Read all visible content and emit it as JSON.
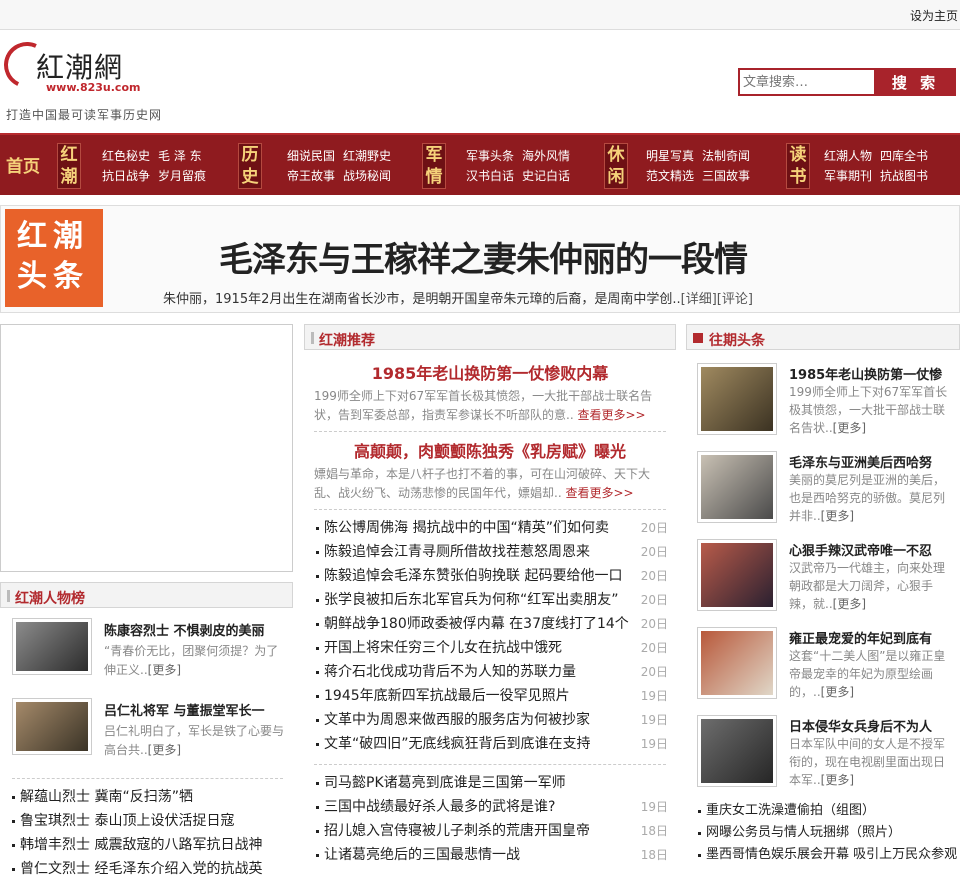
{
  "topbar": {
    "set_home": "设为主页"
  },
  "logo": {
    "name": "紅潮網",
    "url": "www.823u.com",
    "slogan": "打造中国最可读军事历史网"
  },
  "search": {
    "placeholder": "文章搜索…",
    "button": "搜 索"
  },
  "nav": {
    "home": "首页",
    "groups": [
      {
        "cat": "红潮",
        "links": [
          "红色秘史",
          "毛 泽 东",
          "抗日战争",
          "岁月留痕"
        ]
      },
      {
        "cat": "历史",
        "links": [
          "细说民国",
          "红潮野史",
          "帝王故事",
          "战场秘闻"
        ]
      },
      {
        "cat": "军情",
        "links": [
          "军事头条",
          "海外风情",
          "汉书白话",
          "史记白话"
        ]
      },
      {
        "cat": "休闲",
        "links": [
          "明星写真",
          "法制奇闻",
          "范文精选",
          "三国故事"
        ]
      },
      {
        "cat": "读书",
        "links": [
          "红潮人物",
          "四库全书",
          "军事期刊",
          "抗战图书"
        ]
      }
    ]
  },
  "headline": {
    "badge": "红潮头条",
    "title": "毛泽东与王稼祥之妻朱仲丽的一段情",
    "summary": "朱仲丽，1915年2月出生在湖南省长沙市，是明朝开国皇帝朱元璋的后裔，是周南中学创..",
    "detail": "[详细]",
    "comment": "[评论]"
  },
  "people": {
    "title": "红潮人物榜",
    "featured": [
      {
        "title": "陈康容烈士  不惧剥皮的美丽",
        "desc": "“青春价无比，团聚何须提？为了伸正义..",
        "more": "[更多]"
      },
      {
        "title": "吕仁礼将军  与董振堂军长一",
        "desc": "吕仁礼明白了，军长是铁了心要与高台共..",
        "more": "[更多]"
      }
    ],
    "list": [
      "解蕴山烈士  冀南“反扫荡”牺",
      "鲁宝琪烈士  泰山顶上设伏活捉日寇",
      "韩增丰烈士  威震敌寇的八路军抗日战神",
      "曾仁文烈士  经毛泽东介绍入党的抗战英"
    ]
  },
  "recommend": {
    "title": "红潮推荐",
    "items": [
      {
        "title": "1985年老山换防第一仗惨败内幕",
        "desc": "199师全师上下对67军军首长极其愤怨，一大批干部战士联名告状，告到军委总部，指责军参谋长不听部队的意..",
        "more": "查看更多>>"
      },
      {
        "title": "高颠颠，肉颤颤陈独秀《乳房赋》曝光",
        "desc": "嫖娼与革命，本是八杆子也打不着的事，可在山河破碎、天下大乱、战火纷飞、动荡悲惨的民国年代，嫖娼却..",
        "more": "查看更多>>"
      }
    ],
    "list1": [
      {
        "t": "陈公博周佛海  揭抗战中的中国“精英”们如何卖",
        "d": "20日"
      },
      {
        "t": "陈毅追悼会江青寻厕所借故找茬惹怒周恩来",
        "d": "20日"
      },
      {
        "t": "陈毅追悼会毛泽东赞张伯驹挽联  起码要给他一口",
        "d": "20日"
      },
      {
        "t": "张学良被扣后东北军官兵为何称“红军出卖朋友”",
        "d": "20日"
      },
      {
        "t": "朝鲜战争180师政委被俘内幕  在37度线打了14个",
        "d": "20日"
      },
      {
        "t": "开国上将宋任穷三个儿女在抗战中饿死",
        "d": "20日"
      },
      {
        "t": "蒋介石北伐成功背后不为人知的苏联力量",
        "d": "20日"
      },
      {
        "t": "1945年底新四军抗战最后一役罕见照片",
        "d": "19日"
      },
      {
        "t": "文革中为周恩来做西服的服务店为何被抄家",
        "d": "19日"
      },
      {
        "t": "文革“破四旧”无底线疯狂背后到底谁在支持",
        "d": "19日"
      }
    ],
    "list2": [
      {
        "t": "司马懿PK诸葛亮到底谁是三国第一军师",
        "d": ""
      },
      {
        "t": "三国中战绩最好杀人最多的武将是谁?",
        "d": "19日"
      },
      {
        "t": "招儿媳入宫侍寝被儿子刺杀的荒唐开国皇帝",
        "d": "18日"
      },
      {
        "t": "让诸葛亮绝后的三国最悲情一战",
        "d": "18日"
      }
    ]
  },
  "past": {
    "title": "往期头条",
    "items": [
      {
        "title": "1985年老山换防第一仗惨",
        "desc": "199师全师上下对67军军首长极其愤怨，一大批干部战士联名告状..",
        "more": "[更多]"
      },
      {
        "title": "毛泽东与亚洲美后西哈努",
        "desc": "美丽的莫尼列是亚洲的美后，也是西哈努克的骄傲。莫尼列并非..",
        "more": "[更多]"
      },
      {
        "title": "心狠手辣汉武帝唯一不忍",
        "desc": "汉武帝乃一代雄主，向来处理朝政都是大刀阔斧，心狠手辣，就..",
        "more": "[更多]"
      },
      {
        "title": "雍正最宠爱的年妃到底有",
        "desc": "这套“十二美人图”是以雍正皇帝最宠幸的年妃为原型绘画的，..",
        "more": "[更多]"
      },
      {
        "title": "日本侵华女兵身后不为人",
        "desc": "日本军队中间的女人是不授军衔的，现在电视剧里面出现日本军..",
        "more": "[更多]"
      }
    ],
    "list": [
      "重庆女工洗澡遭偷拍（组图）",
      "网曝公务员与情人玩捆绑（照片）",
      "墨西哥情色娱乐展会开幕  吸引上万民众参观"
    ]
  }
}
